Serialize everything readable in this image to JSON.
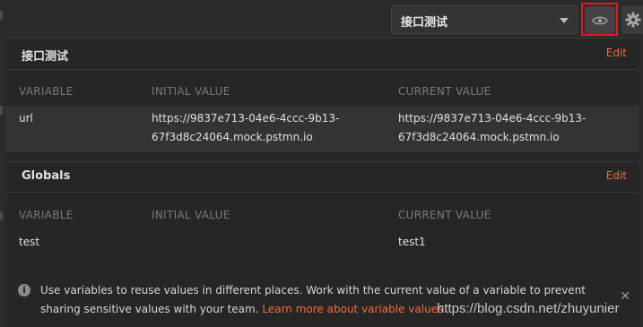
{
  "environment_select": {
    "selected": "接口测试"
  },
  "top_icons": {
    "eye": "eye-icon",
    "settings": "gear-icon"
  },
  "colors": {
    "accent": "#f26b3a",
    "highlight_border": "#e11b1b",
    "panel_bg": "#262626"
  },
  "environment_section": {
    "title": "接口测试",
    "edit_label": "Edit",
    "columns": [
      "VARIABLE",
      "INITIAL VALUE",
      "CURRENT VALUE"
    ],
    "rows": [
      {
        "variable": "url",
        "initial_line1": "https://9837e713-04e6-4ccc-9b13-",
        "initial_line2": "67f3d8c24064.mock.pstmn.io",
        "current_line1": "https://9837e713-04e6-4ccc-9b13-",
        "current_line2": "67f3d8c24064.mock.pstmn.io"
      }
    ]
  },
  "globals_section": {
    "title": "Globals",
    "edit_label": "Edit",
    "columns": [
      "VARIABLE",
      "INITIAL VALUE",
      "CURRENT VALUE"
    ],
    "rows": [
      {
        "variable": "test",
        "initial": "",
        "current": "test1"
      }
    ]
  },
  "info": {
    "text": "Use variables to reuse values in different places. Work with the current value of a variable to prevent sharing sensitive values with your team.",
    "link": "Learn more about variable values",
    "close": "✕"
  },
  "watermark": "https://blog.csdn.net/zhuyunier"
}
